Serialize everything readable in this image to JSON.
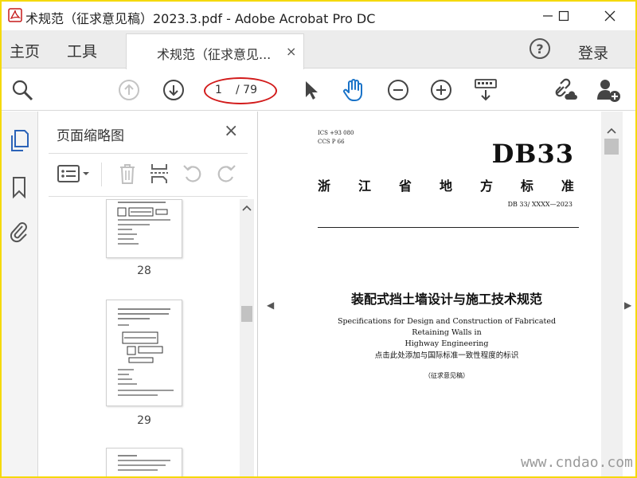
{
  "window": {
    "title": "术规范（征求意见稿）2023.3.pdf - Adobe Acrobat Pro DC"
  },
  "menubar": {
    "home": "主页",
    "tools": "工具",
    "tab_label": "术规范（征求意见...",
    "tab_close": "×",
    "help": "?",
    "login": "登录"
  },
  "toolbar": {
    "page_current": "1",
    "page_total": "/ 79"
  },
  "thumbnails": {
    "title": "页面缩略图",
    "close": "×",
    "pages": [
      {
        "label": "28"
      },
      {
        "label": "29"
      }
    ]
  },
  "document": {
    "ics_line1": "ICS  +93  080",
    "ics_line2": "CCS  P  66",
    "db_code": "DB33",
    "province_chars": [
      "浙",
      "江",
      "省",
      "地",
      "方",
      "标",
      "准"
    ],
    "standard_number": "DB 33/  XXXX—2023",
    "title_cn": "装配式挡土墙设计与施工技术规范",
    "title_en_line1": "Specifications for Design and Construction of Fabricated Retaining Walls in",
    "title_en_line2": "Highway Engineering",
    "note": "点击此处添加与国际标准一致性程度的标识",
    "draft": "（征求意见稿）"
  },
  "watermark": "www.cndao.com",
  "colors": {
    "frame": "#f5d90a",
    "hand_tool": "#1a73c8",
    "nav_icon_blue": "#2b63b8",
    "highlight_ellipse": "#d21b1b"
  }
}
